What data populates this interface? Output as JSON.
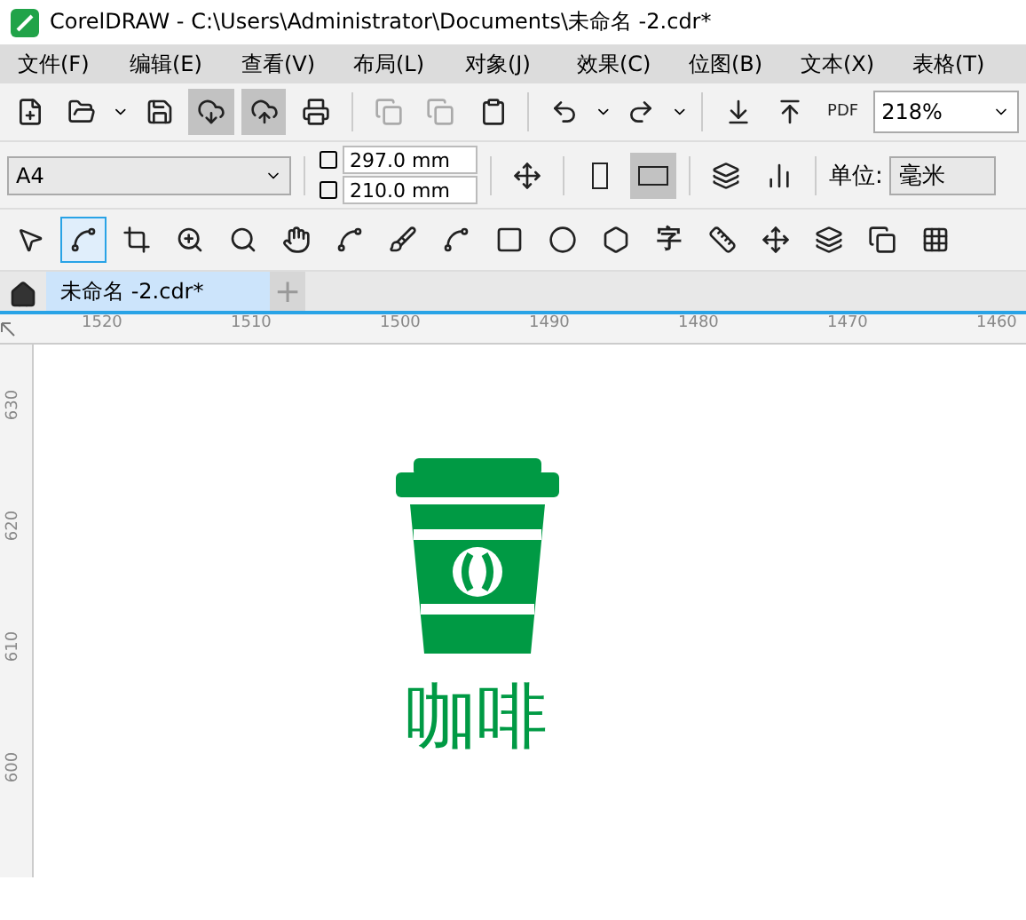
{
  "window": {
    "title": "CorelDRAW - C:\\Users\\Administrator\\Documents\\未命名 -2.cdr*"
  },
  "menu": [
    "文件(F)",
    "编辑(E)",
    "查看(V)",
    "布局(L)",
    "对象(J)",
    "效果(C)",
    "位图(B)",
    "文本(X)",
    "表格(T)"
  ],
  "standard_toolbar": {
    "pdf_label": "PDF",
    "zoom": "218%"
  },
  "property_bar": {
    "page_size": "A4",
    "width": "297.0 mm",
    "height": "210.0 mm",
    "unit_label": "单位:",
    "unit": "毫米",
    "landscape": true
  },
  "toolbox": {
    "tools": [
      {
        "selected": false
      },
      {
        "selected": true
      },
      {
        "selected": false
      },
      {
        "selected": false
      },
      {
        "selected": false
      },
      {
        "selected": false
      },
      {
        "selected": false
      },
      {
        "selected": false
      },
      {
        "selected": false
      },
      {
        "selected": false
      },
      {
        "selected": false
      },
      {
        "selected": false
      },
      {
        "selected": false
      },
      {
        "selected": false
      },
      {
        "selected": false
      },
      {
        "selected": false
      },
      {
        "selected": false
      },
      {
        "selected": false
      }
    ],
    "text_tool": "字"
  },
  "tabs": [
    {
      "label": "未命名 -2.cdr*",
      "selected": true
    }
  ],
  "add_tab": "+",
  "horizontal_ruler": [
    "1520",
    "1510",
    "1500",
    "1490",
    "1480",
    "1470",
    "1460"
  ],
  "vertical_ruler": [
    "630",
    "620",
    "610",
    "600"
  ],
  "canvas": {
    "logo_text": "咖啡"
  }
}
